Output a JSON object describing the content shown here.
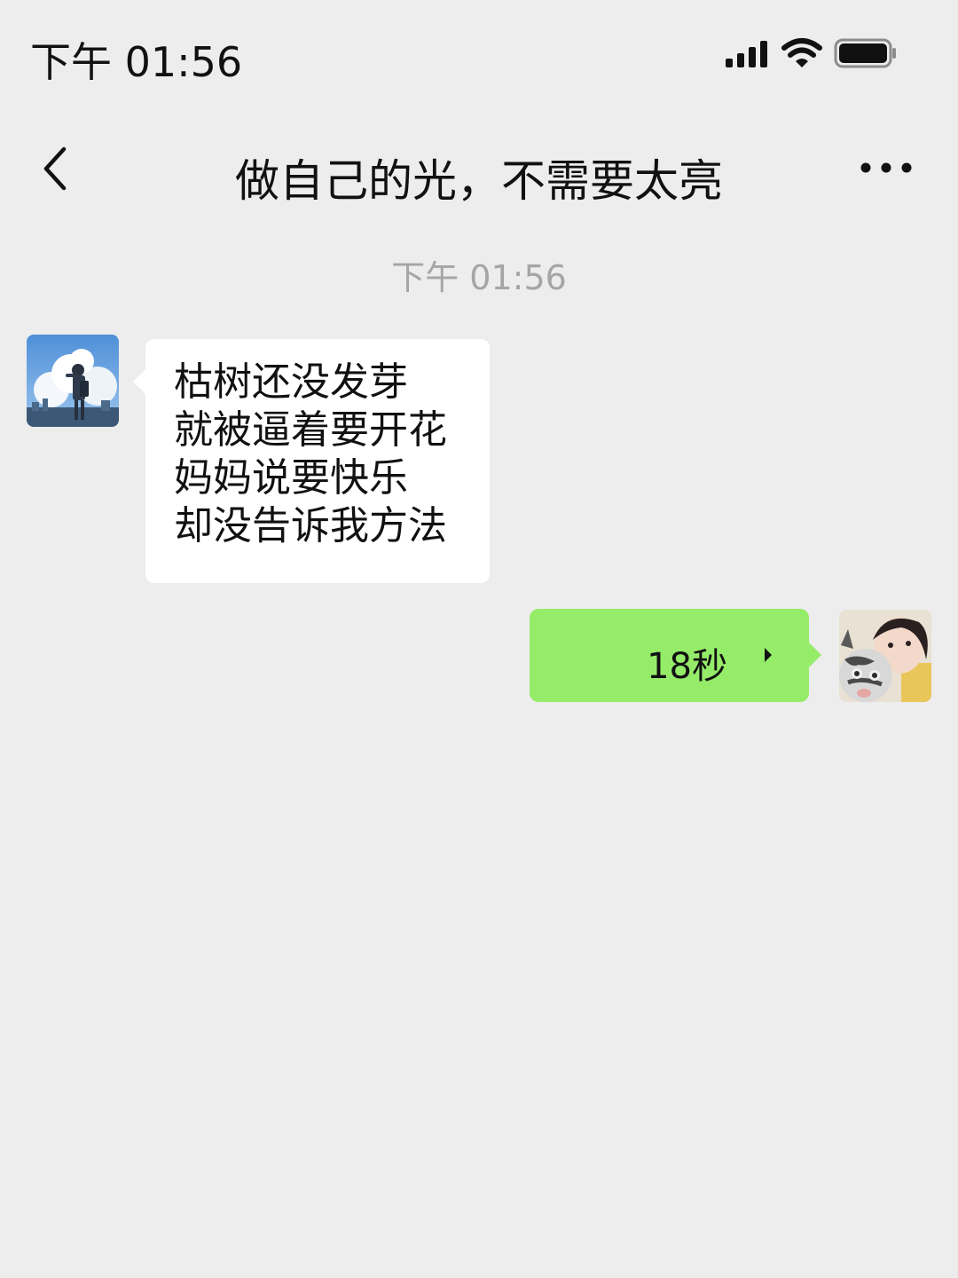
{
  "status_bar": {
    "time": "下午 01:56",
    "icons": [
      "signal-icon",
      "wifi-icon",
      "battery-icon"
    ]
  },
  "nav": {
    "back_icon": "chevron-left-icon",
    "title": "做自己的光，不需要太亮",
    "more_icon": "more-dots-icon"
  },
  "chat": {
    "timestamp": "下午 01:56",
    "messages": [
      {
        "from": "other",
        "type": "text",
        "lines": [
          "枯树还没发芽",
          "就被逼着要开花",
          "妈妈说要快乐",
          "却没告诉我方法"
        ]
      },
      {
        "from": "me",
        "type": "voice",
        "duration": "18秒"
      }
    ]
  },
  "colors": {
    "background": "#ededed",
    "incoming_bubble": "#ffffff",
    "outgoing_bubble": "#95ec69",
    "timestamp_text": "#a5a5a5"
  }
}
